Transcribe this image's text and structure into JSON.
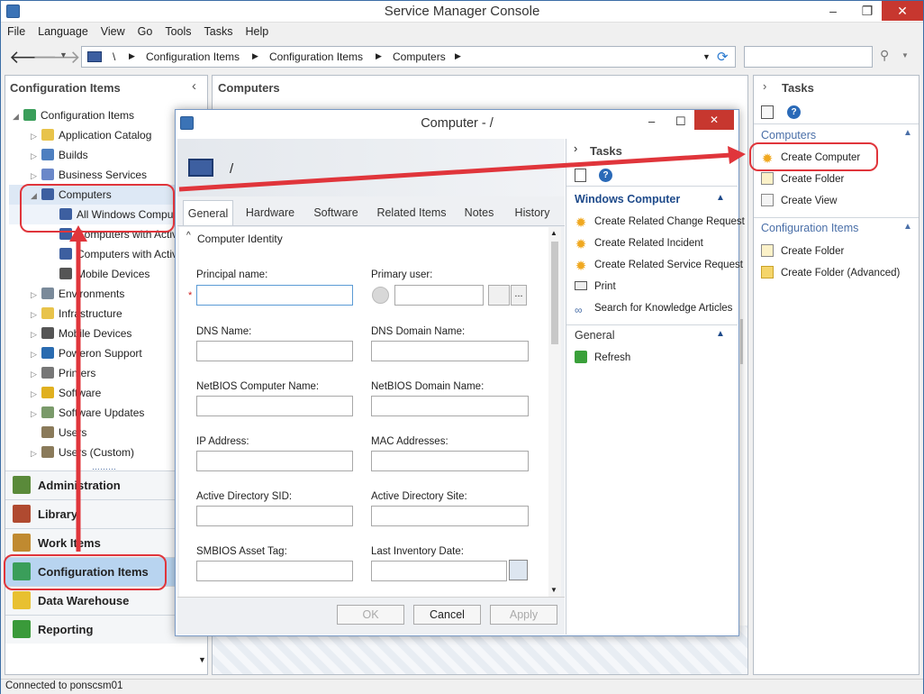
{
  "window": {
    "title": "Service Manager Console",
    "minimize": "–",
    "restore": "❐",
    "close": "✕"
  },
  "menu": [
    "File",
    "Language",
    "View",
    "Go",
    "Tools",
    "Tasks",
    "Help"
  ],
  "breadcrumb": {
    "root": "\\",
    "items": [
      "Configuration Items",
      "Configuration Items",
      "Computers"
    ]
  },
  "left": {
    "title": "Configuration Items",
    "tree": [
      {
        "label": "Configuration Items",
        "lvl": 0,
        "tri": "◢",
        "color": "#3a9e5a"
      },
      {
        "label": "Application Catalog",
        "lvl": 1,
        "tri": "▷",
        "color": "#e8c34a"
      },
      {
        "label": "Builds",
        "lvl": 1,
        "tri": "▷",
        "color": "#4e7fc0"
      },
      {
        "label": "Business Services",
        "lvl": 1,
        "tri": "▷",
        "color": "#6b88c9"
      },
      {
        "label": "Computers",
        "lvl": 1,
        "tri": "◢",
        "color": "#3d5fa0"
      },
      {
        "label": "All Windows Computers",
        "lvl": 2,
        "tri": "",
        "color": "#3d5fa0"
      },
      {
        "label": "Computers with Active",
        "lvl": 2,
        "tri": "",
        "color": "#3d5fa0"
      },
      {
        "label": "Computers with Active",
        "lvl": 2,
        "tri": "",
        "color": "#3d5fa0"
      },
      {
        "label": "Mobile Devices",
        "lvl": 2,
        "tri": "",
        "color": "#555"
      },
      {
        "label": "Environments",
        "lvl": 1,
        "tri": "▷",
        "color": "#7a8a9a"
      },
      {
        "label": "Infrastructure",
        "lvl": 1,
        "tri": "▷",
        "color": "#e8c34a"
      },
      {
        "label": "Mobile Devices",
        "lvl": 1,
        "tri": "▷",
        "color": "#555"
      },
      {
        "label": "Poweron Support",
        "lvl": 1,
        "tri": "▷",
        "color": "#2a6bb0"
      },
      {
        "label": "Printers",
        "lvl": 1,
        "tri": "▷",
        "color": "#777"
      },
      {
        "label": "Software",
        "lvl": 1,
        "tri": "▷",
        "color": "#e0b020"
      },
      {
        "label": "Software Updates",
        "lvl": 1,
        "tri": "▷",
        "color": "#7a9a6a"
      },
      {
        "label": "Users",
        "lvl": 1,
        "tri": "",
        "color": "#8a7a5a"
      },
      {
        "label": "Users (Custom)",
        "lvl": 1,
        "tri": "▷",
        "color": "#8a7a5a"
      }
    ],
    "workspaces": [
      {
        "label": "Administration",
        "color": "#5a8a3a"
      },
      {
        "label": "Library",
        "color": "#b04a30"
      },
      {
        "label": "Work Items",
        "color": "#c08a30"
      },
      {
        "label": "Configuration Items",
        "color": "#3a9e5a"
      },
      {
        "label": "Data Warehouse",
        "color": "#e8c030"
      },
      {
        "label": "Reporting",
        "color": "#3a9a3a"
      }
    ]
  },
  "center": {
    "title": "Computers"
  },
  "tasks_panel": {
    "title": "Tasks",
    "section1": {
      "title": "Computers",
      "items": [
        "Create Computer",
        "Create Folder",
        "Create View"
      ]
    },
    "section2": {
      "title": "Configuration Items",
      "items": [
        "Create Folder",
        "Create Folder (Advanced)"
      ]
    }
  },
  "dialog": {
    "title": "Computer - /",
    "header_name": "/",
    "tabs": [
      "General",
      "Hardware",
      "Software",
      "Related Items",
      "Notes",
      "History"
    ],
    "section": "Computer Identity",
    "fields": {
      "principal": "Principal name:",
      "primary_user": "Primary user:",
      "dns": "DNS Name:",
      "dns_domain": "DNS Domain Name:",
      "netbios": "NetBIOS Computer Name:",
      "netbios_domain": "NetBIOS Domain Name:",
      "ip": "IP Address:",
      "mac": "MAC Addresses:",
      "ad_sid": "Active Directory SID:",
      "ad_site": "Active Directory Site:",
      "smbios": "SMBIOS Asset Tag:",
      "inventory": "Last Inventory Date:"
    },
    "required": "*",
    "ellipsis": "...",
    "buttons": {
      "ok": "OK",
      "cancel": "Cancel",
      "apply": "Apply"
    },
    "tasks": {
      "title": "Tasks",
      "group1": "Windows Computer",
      "items": [
        "Create Related Change Request",
        "Create Related Incident",
        "Create Related Service Request",
        "Print",
        "Search for Knowledge Articles"
      ],
      "group2": "General",
      "group2_items": [
        "Refresh"
      ]
    }
  },
  "status": "Connected to ponscsm01",
  "accent": "#e0353b"
}
